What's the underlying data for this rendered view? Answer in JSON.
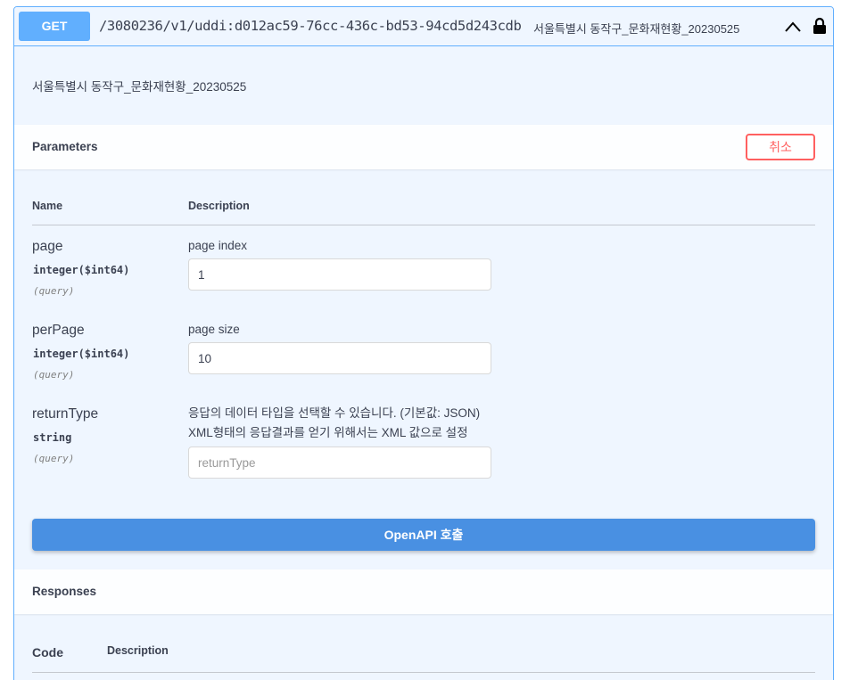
{
  "endpoint": {
    "method": "GET",
    "path": "/3080236/v1/uddi:d012ac59-76cc-436c-bd53-94cd5d243cdb",
    "summary": "서울특별시 동작구_문화재현황_20230525",
    "description": "서울특별시 동작구_문화재현황_20230525",
    "collapse_icon": "chevron-up-icon",
    "lock_icon": "lock-icon"
  },
  "parameters": {
    "title": "Parameters",
    "cancel_label": "취소",
    "col_name": "Name",
    "col_description": "Description",
    "items": [
      {
        "name": "page",
        "type": "integer($int64)",
        "in": "(query)",
        "description": "page index",
        "value": "1",
        "placeholder": ""
      },
      {
        "name": "perPage",
        "type": "integer($int64)",
        "in": "(query)",
        "description": "page size",
        "value": "10",
        "placeholder": ""
      },
      {
        "name": "returnType",
        "type": "string",
        "in": "(query)",
        "description_line1": "응답의 데이터 타입을 선택할 수 있습니다. (기본값: JSON)",
        "description_line2": "XML형태의 응답결과를 얻기 위해서는 XML 값으로 설정",
        "value": "",
        "placeholder": "returnType"
      }
    ]
  },
  "execute_label": "OpenAPI 호출",
  "responses": {
    "title": "Responses",
    "col_code": "Code",
    "col_description": "Description"
  },
  "colors": {
    "get_accent": "#61affe",
    "block_bg": "#eff6ff",
    "cancel_red": "#ff6060",
    "execute_blue": "#4990e2"
  }
}
